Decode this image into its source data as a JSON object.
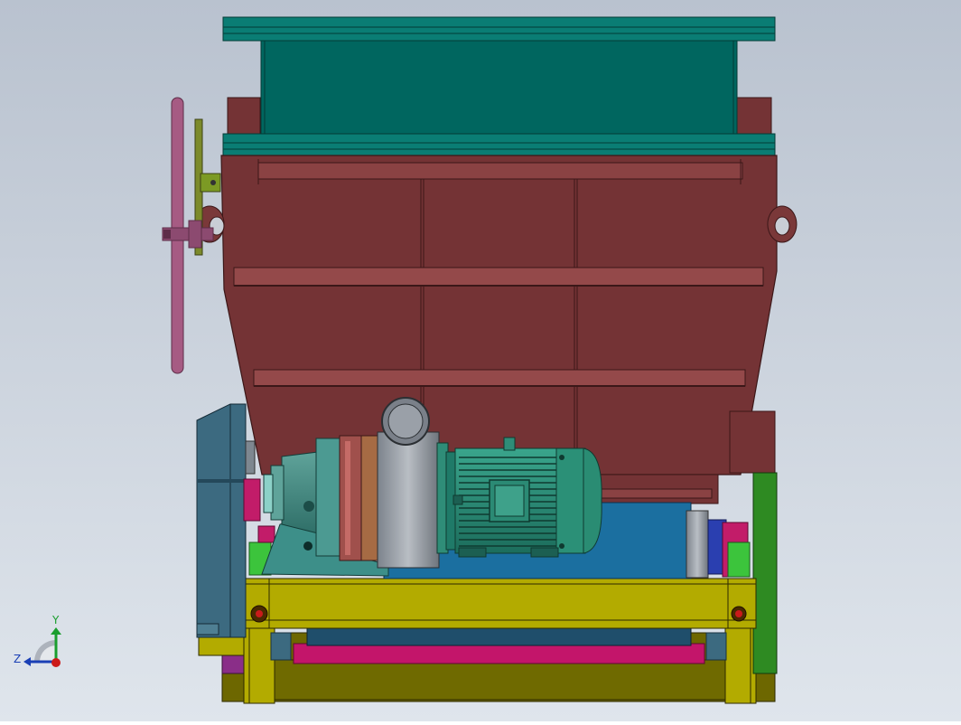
{
  "viewport": {
    "background_top": "#b9c2cf",
    "background_bottom": "#dfe5ec"
  },
  "colors": {
    "hopper_teal": "#00665f",
    "hopper_teal_light": "#0d8a80",
    "body_maroon": "#743335",
    "body_maroon_light": "#8e4849",
    "handwheel_pink": "#a65b83",
    "gear_blue": "#3c6a80",
    "motor_teal": "#2f8d78",
    "motor_dark": "#17574a",
    "frame_olive": "#b3ab00",
    "frame_olive_dark": "#6d6700",
    "base_pink": "#c3156a",
    "support_green": "#2e8a22",
    "bright_green": "#3cc43c",
    "gray_housing": "#9aa0a8"
  },
  "axis_triad": {
    "y_label": "Y",
    "z_label": "Z",
    "y_color": "#1a9e2e",
    "z_color": "#1a3fb5",
    "origin_color": "#cc1a1a"
  },
  "parts": [
    {
      "name": "feed-hopper",
      "icon": "hopper-icon"
    },
    {
      "name": "crusher-body",
      "icon": "housing-icon"
    },
    {
      "name": "handwheel",
      "icon": "wheel-icon"
    },
    {
      "name": "gear-reducer",
      "icon": "gearbox-icon"
    },
    {
      "name": "electric-motor",
      "icon": "motor-icon"
    },
    {
      "name": "base-frame",
      "icon": "frame-icon"
    }
  ]
}
